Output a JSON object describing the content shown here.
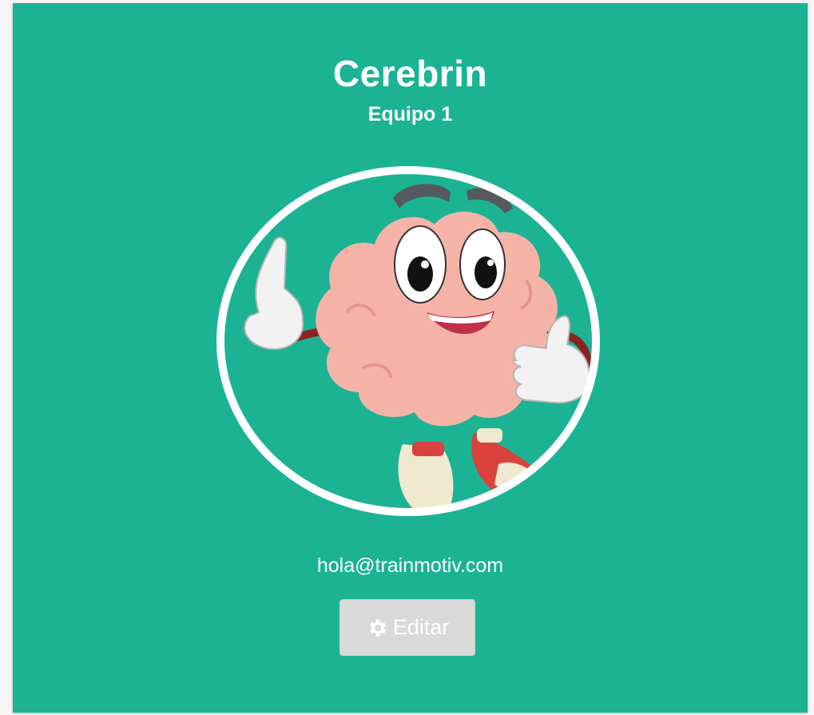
{
  "profile": {
    "name": "Cerebrin",
    "team": "Equipo 1",
    "email": "hola@trainmotiv.com",
    "avatar_icon": "brain-mascot-icon"
  },
  "actions": {
    "edit_label": "Editar",
    "edit_icon": "gear-icon"
  },
  "colors": {
    "card_background": "#1bb394",
    "text": "#ffffff",
    "button_background": "#d9d9d9"
  }
}
